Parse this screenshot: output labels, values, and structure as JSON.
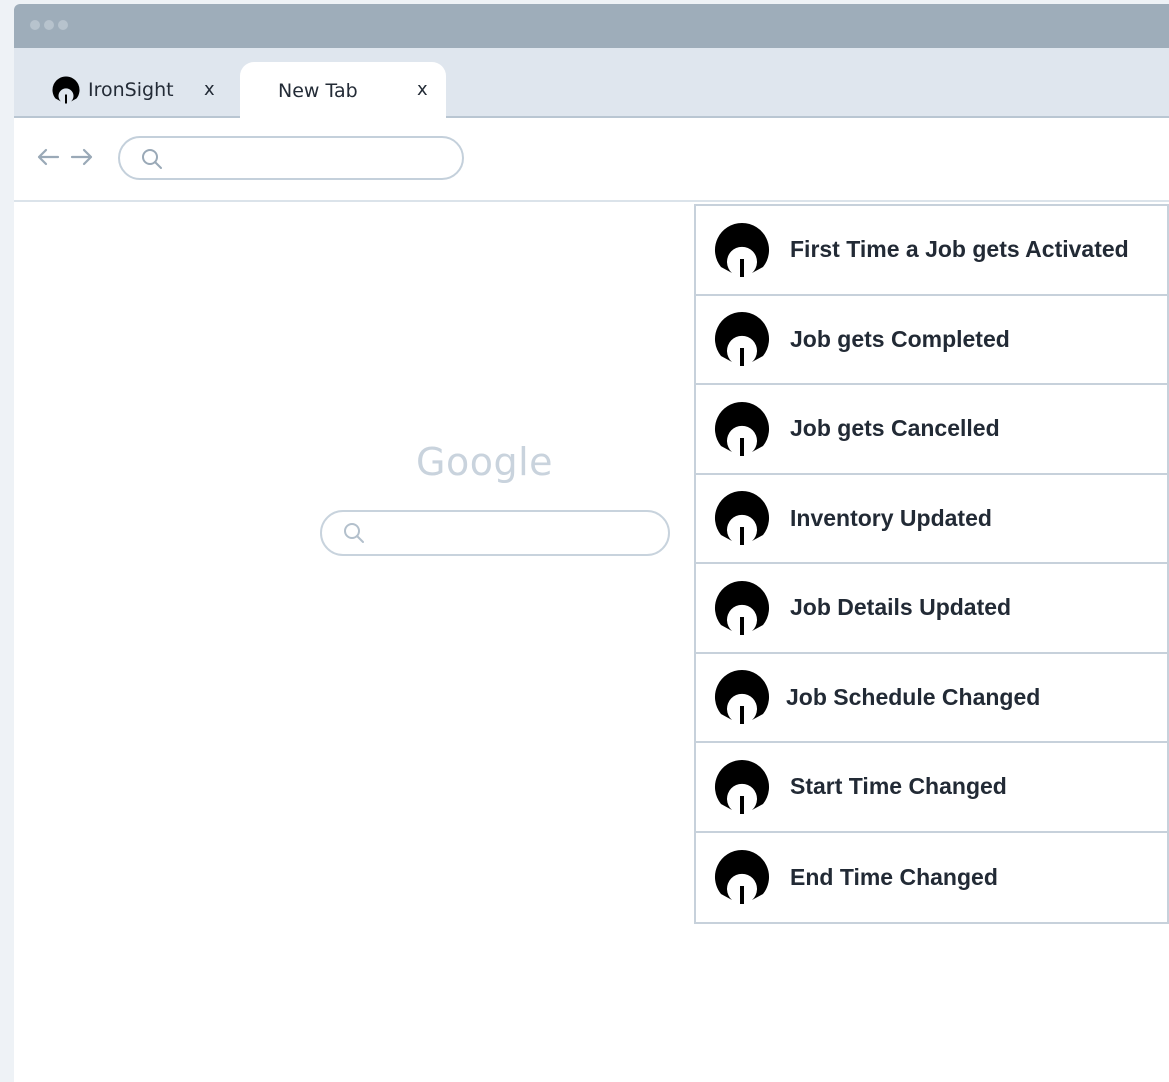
{
  "browser": {
    "tabs": [
      {
        "title": "IronSight",
        "close": "x",
        "icon": "ironsight-logo-icon"
      },
      {
        "title": "New Tab",
        "close": "x"
      }
    ],
    "nav": {
      "back_icon": "arrow-left-icon",
      "forward_icon": "arrow-right-icon"
    },
    "address_bar": {
      "value": "",
      "icon": "search-icon"
    }
  },
  "page": {
    "logo_text": "Google",
    "search": {
      "value": "",
      "icon": "search-icon"
    }
  },
  "dropdown": {
    "icon": "ironsight-logo-icon",
    "items": [
      {
        "label": "First Time a Job gets Activated"
      },
      {
        "label": "Job gets Completed"
      },
      {
        "label": "Job gets Cancelled"
      },
      {
        "label": "Inventory Updated"
      },
      {
        "label": "Job Details Updated"
      },
      {
        "label": "Job Schedule Changed"
      },
      {
        "label": "Start Time Changed"
      },
      {
        "label": "End Time Changed"
      }
    ]
  },
  "colors": {
    "titlebar": "#9eadba",
    "tabbar": "#dfe6ee",
    "border": "#c7d1db",
    "text": "#222a35",
    "muted": "#c9d3dd"
  }
}
